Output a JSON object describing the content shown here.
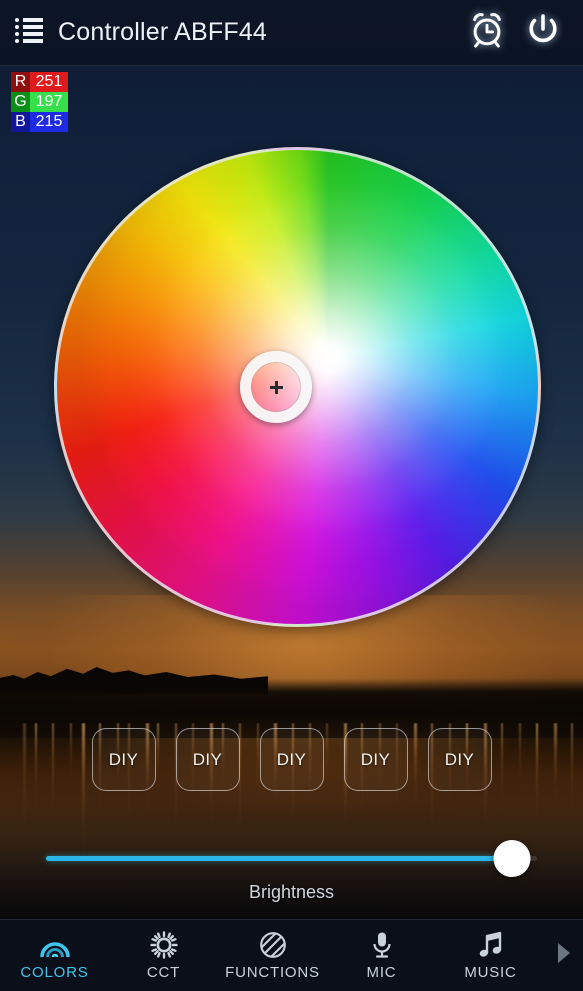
{
  "header": {
    "menu_icon": "list-menu-icon",
    "title": "Controller ABFF44",
    "alarm_icon": "alarm-clock-icon",
    "power_icon": "power-icon"
  },
  "rgb_readout": {
    "rows": [
      {
        "key": "R",
        "value": "251",
        "key_color": "#8f0f0f",
        "value_color": "#e01b1b"
      },
      {
        "key": "G",
        "value": "197",
        "key_color": "#0b8f18",
        "value_color": "#35e04a"
      },
      {
        "key": "B",
        "value": "215",
        "key_color": "#11169a",
        "value_color": "#1d2ae6"
      }
    ]
  },
  "color_wheel": {
    "name": "hsv-color-wheel",
    "cursor_icon": "crosshair-selector"
  },
  "presets": {
    "buttons": [
      {
        "label": "DIY"
      },
      {
        "label": "DIY"
      },
      {
        "label": "DIY"
      },
      {
        "label": "DIY"
      },
      {
        "label": "DIY"
      }
    ]
  },
  "brightness": {
    "label": "Brightness",
    "percent": 95,
    "accent_color": "#2cb6e8"
  },
  "tabbar": {
    "active_color": "#3fc6ef",
    "tabs": [
      {
        "label": "COLORS",
        "icon": "rainbow-icon",
        "active": true
      },
      {
        "label": "CCT",
        "icon": "sun-gear-icon",
        "active": false
      },
      {
        "label": "FUNCTIONS",
        "icon": "striped-circle-icon",
        "active": false
      },
      {
        "label": "MIC",
        "icon": "microphone-icon",
        "active": false
      },
      {
        "label": "MUSIC",
        "icon": "music-note-icon",
        "active": false
      }
    ],
    "more_icon": "chevron-right-icon"
  }
}
